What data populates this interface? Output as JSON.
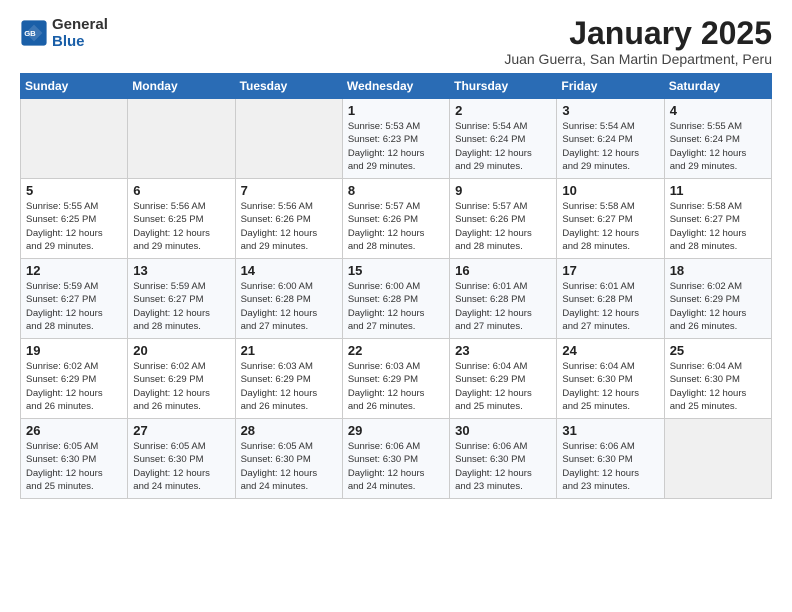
{
  "logo": {
    "line1": "General",
    "line2": "Blue"
  },
  "title": "January 2025",
  "subtitle": "Juan Guerra, San Martin Department, Peru",
  "days_header": [
    "Sunday",
    "Monday",
    "Tuesday",
    "Wednesday",
    "Thursday",
    "Friday",
    "Saturday"
  ],
  "weeks": [
    [
      {
        "day": "",
        "info": ""
      },
      {
        "day": "",
        "info": ""
      },
      {
        "day": "",
        "info": ""
      },
      {
        "day": "1",
        "info": "Sunrise: 5:53 AM\nSunset: 6:23 PM\nDaylight: 12 hours\nand 29 minutes."
      },
      {
        "day": "2",
        "info": "Sunrise: 5:54 AM\nSunset: 6:24 PM\nDaylight: 12 hours\nand 29 minutes."
      },
      {
        "day": "3",
        "info": "Sunrise: 5:54 AM\nSunset: 6:24 PM\nDaylight: 12 hours\nand 29 minutes."
      },
      {
        "day": "4",
        "info": "Sunrise: 5:55 AM\nSunset: 6:24 PM\nDaylight: 12 hours\nand 29 minutes."
      }
    ],
    [
      {
        "day": "5",
        "info": "Sunrise: 5:55 AM\nSunset: 6:25 PM\nDaylight: 12 hours\nand 29 minutes."
      },
      {
        "day": "6",
        "info": "Sunrise: 5:56 AM\nSunset: 6:25 PM\nDaylight: 12 hours\nand 29 minutes."
      },
      {
        "day": "7",
        "info": "Sunrise: 5:56 AM\nSunset: 6:26 PM\nDaylight: 12 hours\nand 29 minutes."
      },
      {
        "day": "8",
        "info": "Sunrise: 5:57 AM\nSunset: 6:26 PM\nDaylight: 12 hours\nand 28 minutes."
      },
      {
        "day": "9",
        "info": "Sunrise: 5:57 AM\nSunset: 6:26 PM\nDaylight: 12 hours\nand 28 minutes."
      },
      {
        "day": "10",
        "info": "Sunrise: 5:58 AM\nSunset: 6:27 PM\nDaylight: 12 hours\nand 28 minutes."
      },
      {
        "day": "11",
        "info": "Sunrise: 5:58 AM\nSunset: 6:27 PM\nDaylight: 12 hours\nand 28 minutes."
      }
    ],
    [
      {
        "day": "12",
        "info": "Sunrise: 5:59 AM\nSunset: 6:27 PM\nDaylight: 12 hours\nand 28 minutes."
      },
      {
        "day": "13",
        "info": "Sunrise: 5:59 AM\nSunset: 6:27 PM\nDaylight: 12 hours\nand 28 minutes."
      },
      {
        "day": "14",
        "info": "Sunrise: 6:00 AM\nSunset: 6:28 PM\nDaylight: 12 hours\nand 27 minutes."
      },
      {
        "day": "15",
        "info": "Sunrise: 6:00 AM\nSunset: 6:28 PM\nDaylight: 12 hours\nand 27 minutes."
      },
      {
        "day": "16",
        "info": "Sunrise: 6:01 AM\nSunset: 6:28 PM\nDaylight: 12 hours\nand 27 minutes."
      },
      {
        "day": "17",
        "info": "Sunrise: 6:01 AM\nSunset: 6:28 PM\nDaylight: 12 hours\nand 27 minutes."
      },
      {
        "day": "18",
        "info": "Sunrise: 6:02 AM\nSunset: 6:29 PM\nDaylight: 12 hours\nand 26 minutes."
      }
    ],
    [
      {
        "day": "19",
        "info": "Sunrise: 6:02 AM\nSunset: 6:29 PM\nDaylight: 12 hours\nand 26 minutes."
      },
      {
        "day": "20",
        "info": "Sunrise: 6:02 AM\nSunset: 6:29 PM\nDaylight: 12 hours\nand 26 minutes."
      },
      {
        "day": "21",
        "info": "Sunrise: 6:03 AM\nSunset: 6:29 PM\nDaylight: 12 hours\nand 26 minutes."
      },
      {
        "day": "22",
        "info": "Sunrise: 6:03 AM\nSunset: 6:29 PM\nDaylight: 12 hours\nand 26 minutes."
      },
      {
        "day": "23",
        "info": "Sunrise: 6:04 AM\nSunset: 6:29 PM\nDaylight: 12 hours\nand 25 minutes."
      },
      {
        "day": "24",
        "info": "Sunrise: 6:04 AM\nSunset: 6:30 PM\nDaylight: 12 hours\nand 25 minutes."
      },
      {
        "day": "25",
        "info": "Sunrise: 6:04 AM\nSunset: 6:30 PM\nDaylight: 12 hours\nand 25 minutes."
      }
    ],
    [
      {
        "day": "26",
        "info": "Sunrise: 6:05 AM\nSunset: 6:30 PM\nDaylight: 12 hours\nand 25 minutes."
      },
      {
        "day": "27",
        "info": "Sunrise: 6:05 AM\nSunset: 6:30 PM\nDaylight: 12 hours\nand 24 minutes."
      },
      {
        "day": "28",
        "info": "Sunrise: 6:05 AM\nSunset: 6:30 PM\nDaylight: 12 hours\nand 24 minutes."
      },
      {
        "day": "29",
        "info": "Sunrise: 6:06 AM\nSunset: 6:30 PM\nDaylight: 12 hours\nand 24 minutes."
      },
      {
        "day": "30",
        "info": "Sunrise: 6:06 AM\nSunset: 6:30 PM\nDaylight: 12 hours\nand 23 minutes."
      },
      {
        "day": "31",
        "info": "Sunrise: 6:06 AM\nSunset: 6:30 PM\nDaylight: 12 hours\nand 23 minutes."
      },
      {
        "day": "",
        "info": ""
      }
    ]
  ]
}
